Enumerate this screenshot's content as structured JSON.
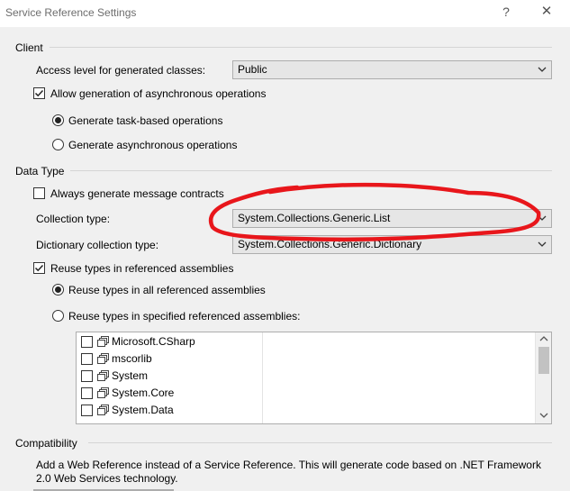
{
  "window": {
    "title": "Service Reference Settings",
    "help_glyph": "?",
    "close_glyph": "✕"
  },
  "client": {
    "heading": "Client",
    "access_level_label": "Access level for generated classes:",
    "access_level_value": "Public",
    "allow_async_label": "Allow generation of asynchronous operations",
    "allow_async_checked": true,
    "task_based_label": "Generate task-based operations",
    "task_based_selected": true,
    "async_ops_label": "Generate asynchronous operations",
    "async_ops_selected": false
  },
  "data_type": {
    "heading": "Data Type",
    "always_contracts_label": "Always generate message contracts",
    "always_contracts_checked": false,
    "collection_type_label": "Collection type:",
    "collection_type_value": "System.Collections.Generic.List",
    "dictionary_type_label": "Dictionary collection type:",
    "dictionary_type_value": "System.Collections.Generic.Dictionary",
    "reuse_types_label": "Reuse types in referenced assemblies",
    "reuse_types_checked": true,
    "reuse_all_label": "Reuse types in all referenced assemblies",
    "reuse_all_selected": true,
    "reuse_specified_label": "Reuse types in specified referenced assemblies:",
    "reuse_specified_selected": false,
    "assemblies": [
      {
        "label": "Microsoft.CSharp",
        "checked": false
      },
      {
        "label": "mscorlib",
        "checked": false
      },
      {
        "label": "System",
        "checked": false
      },
      {
        "label": "System.Core",
        "checked": false
      },
      {
        "label": "System.Data",
        "checked": false
      }
    ]
  },
  "compatibility": {
    "heading": "Compatibility",
    "description": "Add a Web Reference instead of a Service Reference. This will generate code based on .NET Framework 2.0 Web Services technology."
  },
  "colors": {
    "annotation": "#e8161b",
    "combo_bg": "#e6e6e6",
    "dialog_bg": "#f0f0f0"
  }
}
